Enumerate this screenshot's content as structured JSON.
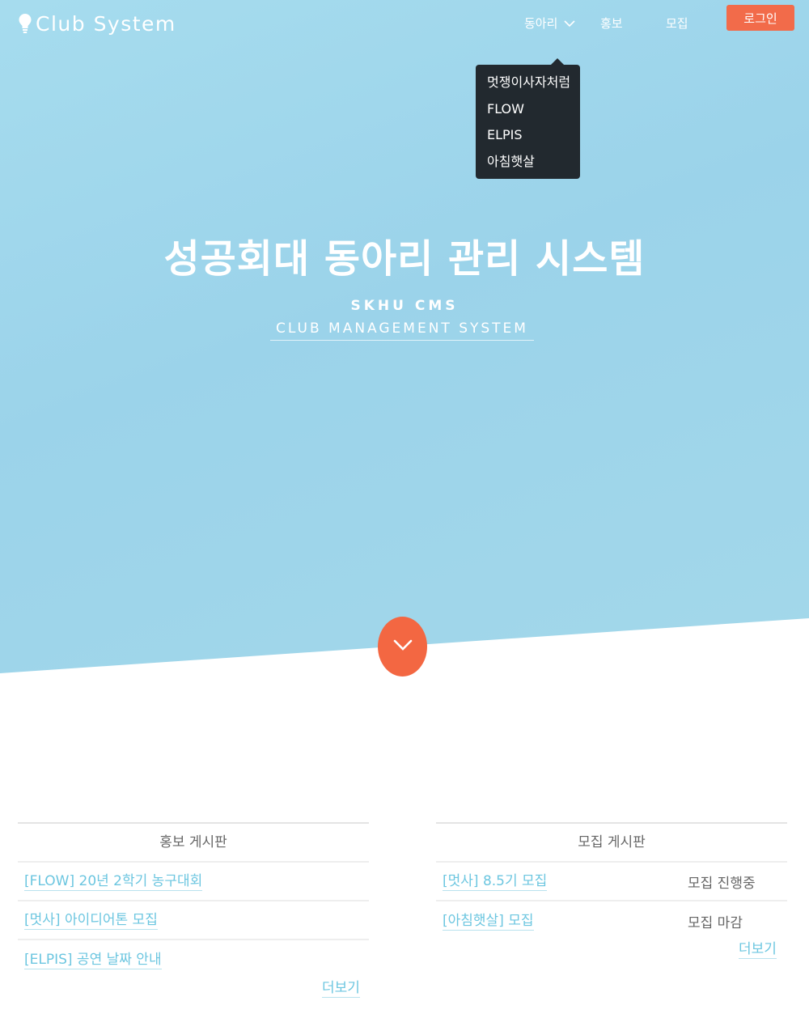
{
  "brand": {
    "icon": "lightbulb-icon",
    "name": "Club System"
  },
  "nav": {
    "clubs_label": "동아리",
    "promo_label": "홍보",
    "recruit_label": "모집",
    "login_label": "로그인",
    "chevron_icon": "chevron-down-icon"
  },
  "dropdown": {
    "items": [
      {
        "label": "멋쟁이사자처럼"
      },
      {
        "label": "FLOW"
      },
      {
        "label": "ELPIS"
      },
      {
        "label": "아침햇살"
      }
    ]
  },
  "hero": {
    "title": "성공회대 동아리 관리 시스템",
    "subtitle": "SKHU CMS",
    "subtitle_link": "CLUB MANAGEMENT SYSTEM",
    "scroll_icon": "chevron-down-icon"
  },
  "promo_board": {
    "title": "홍보 게시판",
    "posts": [
      {
        "title": "[FLOW] 20년 2학기 농구대회"
      },
      {
        "title": "[멋사] 아이디어톤 모집"
      },
      {
        "title": "[ELPIS] 공연 날짜 안내"
      }
    ],
    "more_label": "더보기"
  },
  "recruit_board": {
    "title": "모집 게시판",
    "posts": [
      {
        "title": "[멋사] 8.5기 모집",
        "status": "모집 진행중"
      },
      {
        "title": "[아침햇살] 모집",
        "status": "모집 마감"
      }
    ],
    "more_label": "더보기"
  },
  "colors": {
    "hero_bg": "#9fd6eb",
    "accent": "#f26b4a",
    "link": "#6cc6e0",
    "dropdown_bg": "#22292f"
  }
}
